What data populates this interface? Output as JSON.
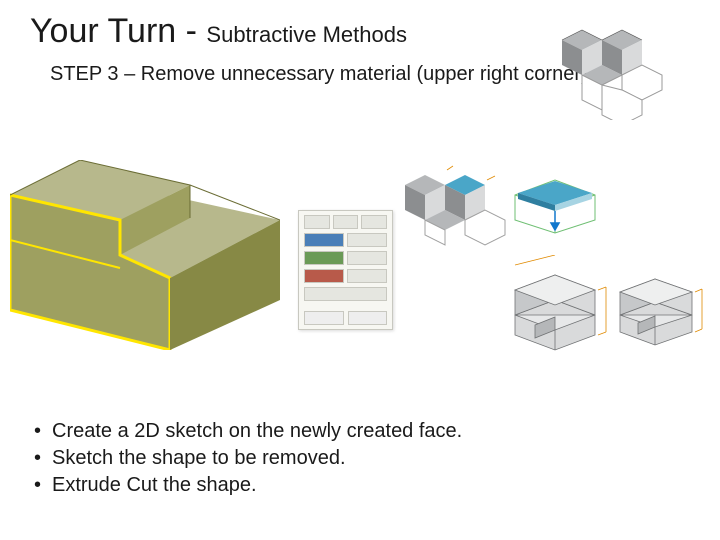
{
  "title": {
    "main": "Your Turn - ",
    "sub": "Subtractive Methods"
  },
  "step": "STEP 3 – Remove unnecessary material (upper right corner)",
  "bullets": [
    "Create a 2D sketch on the newly created face.",
    "Sketch the shape to be removed.",
    "Extrude Cut the shape."
  ],
  "colors": {
    "solid_top": "#b7b88c",
    "solid_front": "#9ea060",
    "solid_side": "#878945",
    "highlight": "#ffe600",
    "gray_light": "#d9dadb",
    "gray_mid": "#b5b7b9",
    "gray_dark": "#8c8e90",
    "blue_face": "#4aa6c8",
    "blue_pale": "#a7d4e3",
    "wire_green": "#6fbf73",
    "arrow_blue": "#1177cc"
  }
}
